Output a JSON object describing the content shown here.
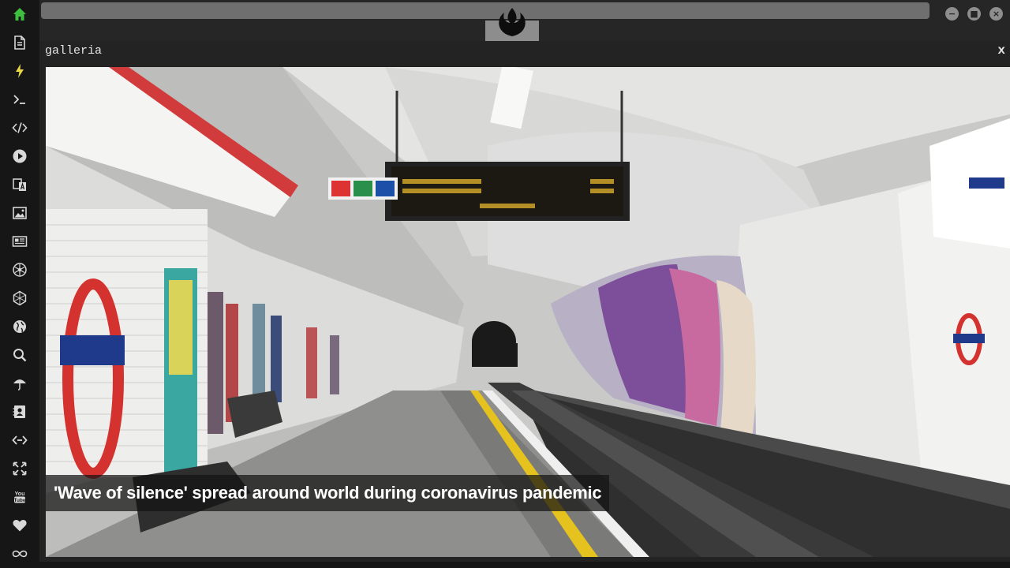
{
  "sidebar": {
    "items": [
      {
        "name": "home-icon",
        "color": "#3fbf3f"
      },
      {
        "name": "document-icon",
        "color": "#d8d8d8"
      },
      {
        "name": "lightning-icon",
        "color": "#e8d84a"
      },
      {
        "name": "terminal-icon",
        "color": "#d8d8d8"
      },
      {
        "name": "code-icon",
        "color": "#d8d8d8"
      },
      {
        "name": "play-icon",
        "color": "#d8d8d8"
      },
      {
        "name": "translate-icon",
        "color": "#d8d8d8"
      },
      {
        "name": "image-icon",
        "color": "#d8d8d8"
      },
      {
        "name": "newspaper-icon",
        "color": "#d8d8d8"
      },
      {
        "name": "atom-icon",
        "color": "#d8d8d8"
      },
      {
        "name": "hexagon-icon",
        "color": "#d8d8d8"
      },
      {
        "name": "globe-icon",
        "color": "#d8d8d8"
      },
      {
        "name": "search-icon",
        "color": "#d8d8d8"
      },
      {
        "name": "umbrella-icon",
        "color": "#d8d8d8"
      },
      {
        "name": "contact-card-icon",
        "color": "#d8d8d8"
      },
      {
        "name": "link-icon",
        "color": "#d8d8d8"
      },
      {
        "name": "expand-icon",
        "color": "#d8d8d8"
      },
      {
        "name": "youtube-icon",
        "color": "#d8d8d8"
      },
      {
        "name": "heart-icon",
        "color": "#d8d8d8"
      },
      {
        "name": "infinity-icon",
        "color": "#d8d8d8"
      }
    ]
  },
  "topbar": {
    "emblem_icon": "rebel-alliance-icon",
    "window_buttons": [
      {
        "name": "minimize",
        "glyph": "−"
      },
      {
        "name": "maximize",
        "glyph": "■"
      },
      {
        "name": "close",
        "glyph": "×"
      }
    ]
  },
  "panel": {
    "title": "galleria",
    "close_label": "x",
    "image_subject": "empty-london-underground-platform",
    "caption": "'Wave of silence' spread around world during coronavirus pandemic"
  },
  "colors": {
    "accent_green": "#3fbf3f",
    "accent_yellow": "#e8d84a",
    "background": "#1b1b1b"
  }
}
